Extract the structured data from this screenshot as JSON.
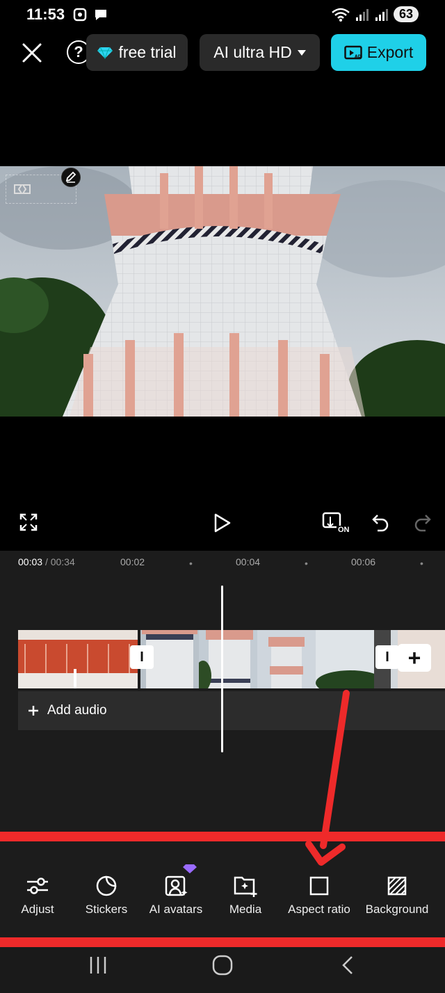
{
  "status_bar": {
    "time": "11:53",
    "battery": "63",
    "icons": [
      "screenshot-icon",
      "chat-icon",
      "wifi-icon",
      "signal-icon",
      "signal-icon"
    ]
  },
  "top_bar": {
    "free_trial_label": "free trial",
    "quality_label": "AI ultra HD",
    "export_label": "Export",
    "help_label": "?"
  },
  "controls": {
    "caption_badge": "ON"
  },
  "timeline": {
    "current_time": "00:03",
    "total_time": "/ 00:34",
    "ticks": [
      "00:02",
      "00:04",
      "00:06"
    ],
    "add_audio_label": "Add audio",
    "transition_symbol": "I",
    "add_clip_symbol": "+"
  },
  "toolbar": {
    "items": [
      {
        "label": "Adjust",
        "icon": "sliders-icon"
      },
      {
        "label": "Stickers",
        "icon": "sticker-icon"
      },
      {
        "label": "AI avatars",
        "icon": "avatar-icon"
      },
      {
        "label": "Media",
        "icon": "media-add-icon"
      },
      {
        "label": "Aspect ratio",
        "icon": "square-icon"
      },
      {
        "label": "Background",
        "icon": "background-icon"
      }
    ]
  },
  "colors": {
    "accent": "#1fd0e8",
    "highlight": "#ee2a2a",
    "premium": "#9a6bff"
  }
}
